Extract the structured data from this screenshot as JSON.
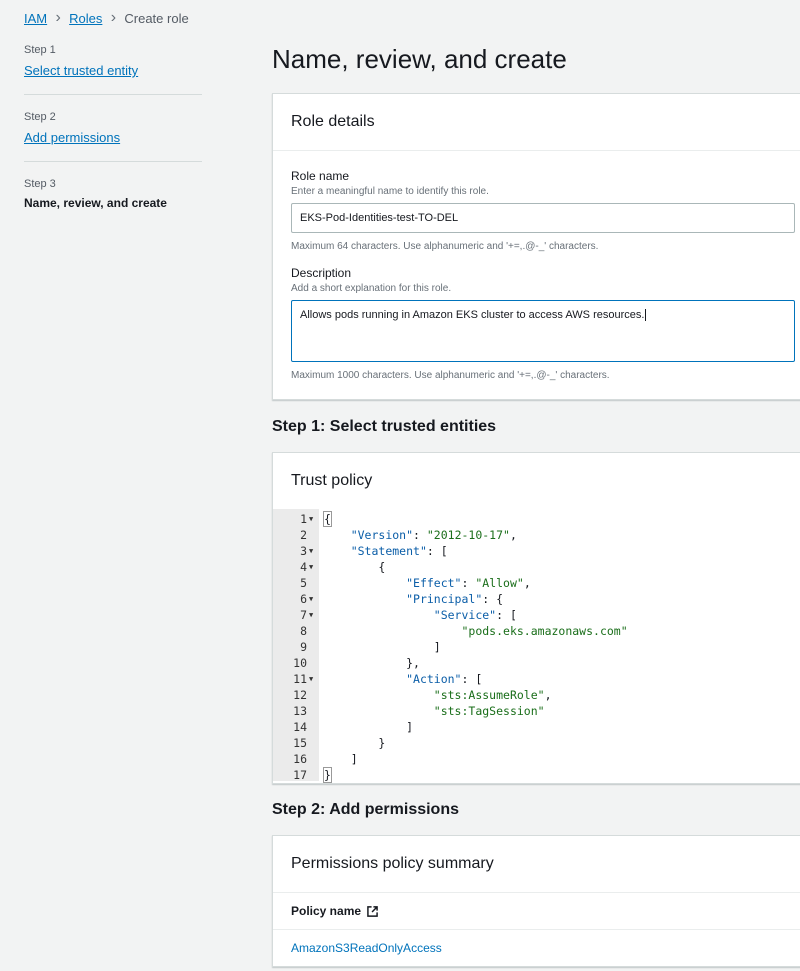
{
  "breadcrumb": {
    "iam": "IAM",
    "roles": "Roles",
    "current": "Create role"
  },
  "nav": [
    {
      "step": "Step 1",
      "label": "Select trusted entity"
    },
    {
      "step": "Step 2",
      "label": "Add permissions"
    },
    {
      "step": "Step 3",
      "label": "Name, review, and create"
    }
  ],
  "page_title": "Name, review, and create",
  "role_details": {
    "title": "Role details",
    "role_name_label": "Role name",
    "role_name_desc": "Enter a meaningful name to identify this role.",
    "role_name_value": "EKS-Pod-Identities-test-TO-DEL",
    "role_name_constraint": "Maximum 64 characters. Use alphanumeric and '+=,.@-_' characters.",
    "description_label": "Description",
    "description_desc": "Add a short explanation for this role.",
    "description_value": "Allows pods running in Amazon EKS cluster to access AWS resources.",
    "description_constraint": "Maximum 1000 characters. Use alphanumeric and '+=,.@-_' characters."
  },
  "step1": {
    "title": "Step 1: Select trusted entities",
    "trust_policy_title": "Trust policy",
    "code_lines": [
      "1",
      "2",
      "3",
      "4",
      "5",
      "6",
      "7",
      "8",
      "9",
      "10",
      "11",
      "12",
      "13",
      "14",
      "15",
      "16",
      "17"
    ],
    "tokens": {
      "version_key": "\"Version\"",
      "version_val": "\"2012-10-17\"",
      "statement_key": "\"Statement\"",
      "effect_key": "\"Effect\"",
      "effect_val": "\"Allow\"",
      "principal_key": "\"Principal\"",
      "service_key": "\"Service\"",
      "service_val": "\"pods.eks.amazonaws.com\"",
      "action_key": "\"Action\"",
      "action_val1": "\"sts:AssumeRole\"",
      "action_val2": "\"sts:TagSession\""
    }
  },
  "step2": {
    "title": "Step 2: Add permissions",
    "summary_title": "Permissions policy summary",
    "column_policy_name": "Policy name",
    "policies": [
      "AmazonS3ReadOnlyAccess"
    ]
  },
  "colors": {
    "link": "#0073bb",
    "background": "#f2f3f3",
    "focus_border": "#0073bb"
  }
}
